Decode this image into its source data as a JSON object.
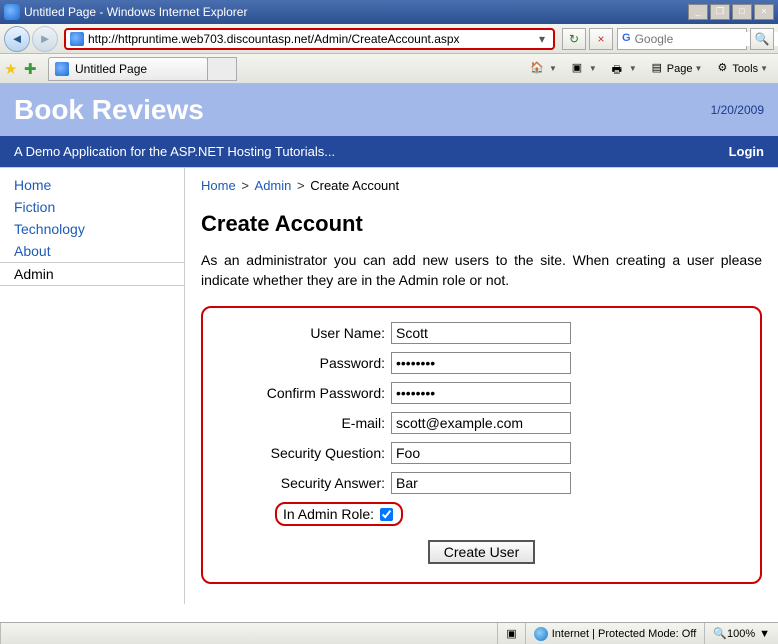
{
  "window": {
    "title": "Untitled Page - Windows Internet Explorer"
  },
  "address_bar": {
    "url": "http://httpruntime.web703.discountasp.net/Admin/CreateAccount.aspx"
  },
  "search": {
    "placeholder": "Google"
  },
  "tab": {
    "title": "Untitled Page"
  },
  "menu": {
    "page": "Page",
    "tools": "Tools"
  },
  "banner": {
    "title": "Book Reviews",
    "date": "1/20/2009",
    "tagline": "A Demo Application for the ASP.NET Hosting Tutorials...",
    "login": "Login"
  },
  "sidebar": {
    "items": [
      {
        "label": "Home"
      },
      {
        "label": "Fiction"
      },
      {
        "label": "Technology"
      },
      {
        "label": "About"
      },
      {
        "label": "Admin"
      }
    ]
  },
  "breadcrumb": {
    "home": "Home",
    "admin": "Admin",
    "current": "Create Account"
  },
  "page_heading": "Create Account",
  "intro": "As an administrator you can add new users to the site. When creating a user please indicate whether they are in the Admin role or not.",
  "form": {
    "username_label": "User Name:",
    "username_value": "Scott",
    "password_label": "Password:",
    "password_value": "••••••••",
    "confirm_label": "Confirm Password:",
    "confirm_value": "••••••••",
    "email_label": "E-mail:",
    "email_value": "scott@example.com",
    "secq_label": "Security Question:",
    "secq_value": "Foo",
    "seca_label": "Security Answer:",
    "seca_value": "Bar",
    "admin_label": "In Admin Role:",
    "admin_checked": true,
    "create_btn": "Create User"
  },
  "status": {
    "zone": "Internet | Protected Mode: Off",
    "zoom": "100%"
  }
}
